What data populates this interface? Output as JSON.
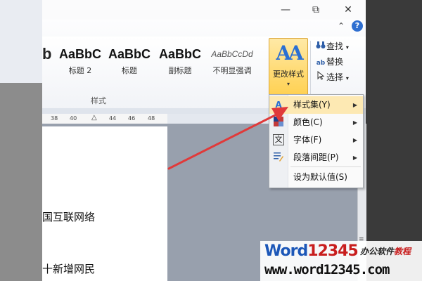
{
  "window": {
    "minimize_glyph": "—",
    "restore_glyph": "⧉",
    "close_glyph": "✕",
    "collapse_glyph": "⌃",
    "help_glyph": "?"
  },
  "styles_gallery": {
    "partial_sample": "b",
    "items": [
      {
        "sample": "AaBbC",
        "name": "标题 2"
      },
      {
        "sample": "AaBbC",
        "name": "标题"
      },
      {
        "sample": "AaBbC",
        "name": "副标题"
      },
      {
        "sample": "AaBbCcDd",
        "name": "不明显强调"
      }
    ],
    "group_label": "样式"
  },
  "change_styles": {
    "icon_text": "AA",
    "label": "更改样式",
    "caret": "▾"
  },
  "editing": {
    "find": {
      "label": "查找",
      "icon": "binoculars-icon",
      "caret": "▾"
    },
    "replace": {
      "label": "替换",
      "icon": "replace-icon"
    },
    "select": {
      "label": "选择",
      "icon": "cursor-icon",
      "caret": "▾"
    }
  },
  "ruler": {
    "ticks": [
      "38",
      "40",
      "44",
      "46",
      "48"
    ]
  },
  "document": {
    "line1": "国互联网络",
    "line2": "十新增网民"
  },
  "change_styles_menu": {
    "items": [
      {
        "label": "样式集(Y)",
        "icon": "style-set-icon",
        "has_submenu": true
      },
      {
        "label": "颜色(C)",
        "icon": "colors-icon",
        "has_submenu": true
      },
      {
        "label": "字体(F)",
        "icon": "fonts-icon",
        "has_submenu": true
      },
      {
        "label": "段落间距(P)",
        "icon": "paragraph-spacing-icon",
        "has_submenu": true
      },
      {
        "label": "设为默认值(S)",
        "icon": "",
        "has_submenu": false
      }
    ],
    "arrow_glyph": "▶"
  },
  "watermark": {
    "logo_w": "W",
    "logo_ord": "ord",
    "logo_num": "12345",
    "tag_a": "办公软件",
    "tag_b": "教程",
    "url": "www.word12345.com"
  },
  "colors": {
    "annotation_arrow": "#e03a3a",
    "highlight_button": "#ffd152"
  }
}
